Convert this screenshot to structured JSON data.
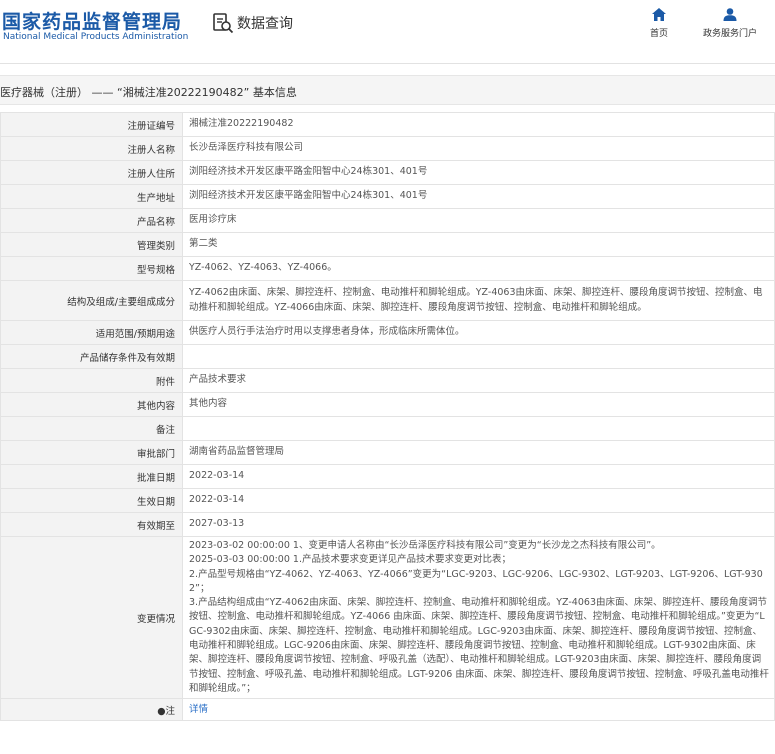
{
  "header": {
    "logo_cn": "国家药品监督管理局",
    "logo_en": "National Medical Products Administration",
    "search_title": "数据查询",
    "nav": [
      {
        "label": "首页",
        "icon": "home-icon"
      },
      {
        "label": "政务服务门户",
        "icon": "user-icon"
      }
    ]
  },
  "breadcrumb": "医疗器械（注册） —— “湘械注准20222190482” 基本信息",
  "colors": {
    "brand": "#1b5aa7",
    "link": "#2a6fc7",
    "label_bg": "#f3f3f3"
  },
  "rows": [
    {
      "label": "注册证编号",
      "value": "湘械注准20222190482"
    },
    {
      "label": "注册人名称",
      "value": "长沙岳泽医疗科技有限公司"
    },
    {
      "label": "注册人住所",
      "value": "浏阳经济技术开发区康平路金阳智中心24栋301、401号"
    },
    {
      "label": "生产地址",
      "value": "浏阳经济技术开发区康平路金阳智中心24栋301、401号"
    },
    {
      "label": "产品名称",
      "value": "医用诊疗床"
    },
    {
      "label": "管理类别",
      "value": "第二类"
    },
    {
      "label": "型号规格",
      "value": "YZ-4062、YZ-4063、YZ-4066。"
    },
    {
      "label": "结构及组成/主要组成成分",
      "value": "YZ-4062由床面、床架、脚控连杆、控制盒、电动推杆和脚轮组成。YZ-4063由床面、床架、脚控连杆、腰段角度调节按钮、控制盒、电动推杆和脚轮组成。YZ-4066由床面、床架、脚控连杆、腰段角度调节按钮、控制盒、电动推杆和脚轮组成。"
    },
    {
      "label": "适用范围/预期用途",
      "value": "供医疗人员行手法治疗时用以支撑患者身体，形成临床所需体位。"
    },
    {
      "label": "产品储存条件及有效期",
      "value": ""
    },
    {
      "label": "附件",
      "value": "产品技术要求"
    },
    {
      "label": "其他内容",
      "value": "其他内容"
    },
    {
      "label": "备注",
      "value": ""
    },
    {
      "label": "审批部门",
      "value": "湖南省药品监督管理局"
    },
    {
      "label": "批准日期",
      "value": "2022-03-14"
    },
    {
      "label": "生效日期",
      "value": "2022-03-14"
    },
    {
      "label": "有效期至",
      "value": "2027-03-13"
    }
  ],
  "change": {
    "label": "变更情况",
    "lines": [
      "2023-03-02 00:00:00 1、变更申请人名称由“长沙岳泽医疗科技有限公司”变更为“长沙龙之杰科技有限公司”。",
      "2025-03-03 00:00:00 1.产品技术要求变更详见产品技术要求变更对比表；",
      "2.产品型号规格由“YZ-4062、YZ-4063、YZ-4066”变更为“LGC-9203、LGC-9206、LGC-9302、LGT-9203、LGT-9206、LGT-9302”；",
      "3.产品结构组成由“YZ-4062由床面、床架、脚控连杆、控制盒、电动推杆和脚轮组成。YZ-4063由床面、床架、脚控连杆、腰段角度调节按钮、控制盒、电动推杆和脚轮组成。YZ-4066 由床面、床架、脚控连杆、腰段角度调节按钮、控制盒、电动推杆和脚轮组成。”变更为“LGC-9302由床面、床架、脚控连杆、控制盒、电动推杆和脚轮组成。LGC-9203由床面、床架、脚控连杆、腰段角度调节按钮、控制盒、电动推杆和脚轮组成。LGC-9206由床面、床架、脚控连杆、腰段角度调节按钮、控制盒、电动推杆和脚轮组成。LGT-9302由床面、床架、脚控连杆、腰段角度调节按钮、控制盒、呼吸孔盖（选配）、电动推杆和脚轮组成。LGT-9203由床面、床架、脚控连杆、腰段角度调节按钮、控制盒、呼吸孔盖、电动推杆和脚轮组成。LGT-9206 由床面、床架、脚控连杆、腰段角度调节按钮、控制盒、呼吸孔盖电动推杆和脚轮组成。”；"
    ]
  },
  "note_row": {
    "label": "●注",
    "value": "详情"
  }
}
